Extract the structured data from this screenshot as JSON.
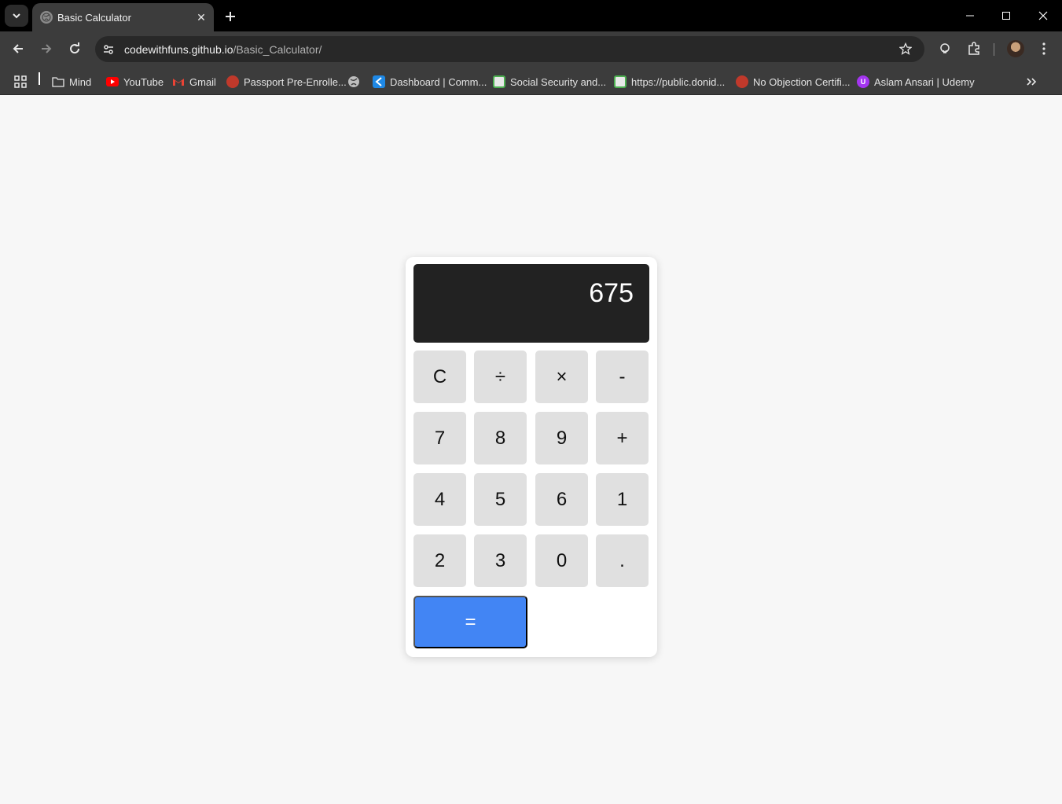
{
  "browser": {
    "tab_title": "Basic Calculator",
    "url_host": "codewithfuns.github.io",
    "url_path": "/Basic_Calculator/"
  },
  "bookmarks": [
    {
      "label": "Mind",
      "icon": "folder-icon"
    },
    {
      "label": "YouTube",
      "icon": "youtube-icon",
      "color": "#ff0000"
    },
    {
      "label": "Gmail",
      "icon": "gmail-icon",
      "color": "#ea4335"
    },
    {
      "label": "Passport Pre-Enrolle...",
      "icon": "passport-icon",
      "color": "#c0392b"
    },
    {
      "label": "",
      "icon": "globe-icon"
    },
    {
      "label": "Dashboard | Comm...",
      "icon": "dashboard-icon",
      "color": "#1e88e5"
    },
    {
      "label": "Social Security and...",
      "icon": "social-security-icon",
      "color": "#4caf50"
    },
    {
      "label": "https://public.donid...",
      "icon": "donid-icon",
      "color": "#4caf50"
    },
    {
      "label": "No Objection Certifi...",
      "icon": "noc-icon",
      "color": "#c0392b"
    },
    {
      "label": "Aslam Ansari | Udemy",
      "icon": "udemy-icon",
      "color": "#a435f0"
    }
  ],
  "calculator": {
    "display": "675",
    "keys": [
      "C",
      "÷",
      "×",
      "-",
      "7",
      "8",
      "9",
      "+",
      "4",
      "5",
      "6",
      "1",
      "2",
      "3",
      "0",
      "."
    ],
    "equals": "=",
    "accent_color": "#4285f4"
  }
}
